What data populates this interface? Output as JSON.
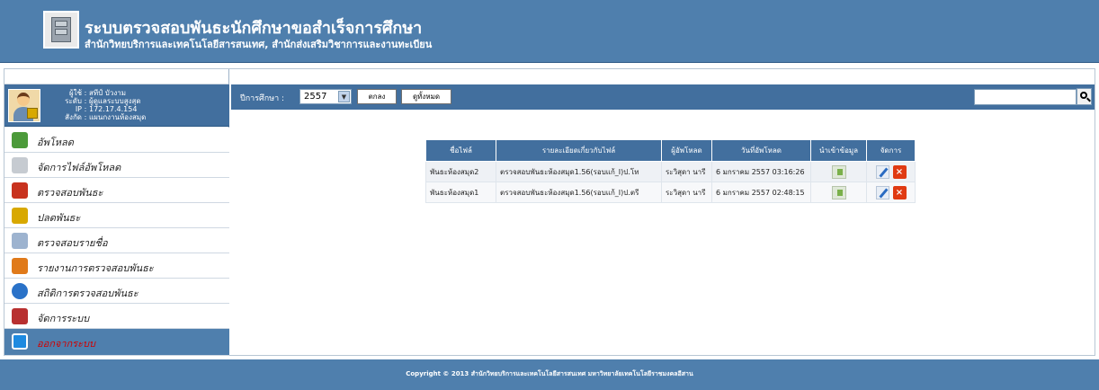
{
  "header": {
    "title": "ระบบตรวจสอบพันธะนักศึกษาขอสำเร็จการศึกษา",
    "subtitle": "สำนักวิทยบริการและเทคโนโลยีสารสนเทศ, สำนักส่งเสริมวิชาการและงานทะเบียน"
  },
  "user": {
    "fields": [
      {
        "key": "ผู้ใช้",
        "value": "สทีป์ บัวงาม"
      },
      {
        "key": "ระดับ",
        "value": "ผู้ดูแลระบบสูงสุด"
      },
      {
        "key": "IP",
        "value": "172.17.4.154"
      },
      {
        "key": "สังกัด",
        "value": "แผนกงานห้องสมุด"
      }
    ]
  },
  "menu": [
    {
      "label": "อัพโหลด",
      "icon": "upload-icon",
      "color": "#4c9a3a"
    },
    {
      "label": "จัดการไฟล์อัพโหลด",
      "icon": "file-manage-icon",
      "color": "#8a8f96"
    },
    {
      "label": "ตรวจสอบพันธะ",
      "icon": "user-check-icon",
      "color": "#c8321e"
    },
    {
      "label": "ปลดพันธะ",
      "icon": "user-release-icon",
      "color": "#d8a800"
    },
    {
      "label": "ตรวจสอบรายชื่อ",
      "icon": "magnifier-icon",
      "color": "#5a7fb2"
    },
    {
      "label": "รายงานการตรวจสอบพันธะ",
      "icon": "report-icon",
      "color": "#e07a1a"
    },
    {
      "label": "สถิติการตรวจสอบพันธะ",
      "icon": "pie-chart-icon",
      "color": "#2a72c8"
    },
    {
      "label": "จัดการระบบ",
      "icon": "tools-icon",
      "color": "#b83030"
    },
    {
      "label": "ออกจากระบบ",
      "icon": "power-icon",
      "color": "#1e8ae0"
    }
  ],
  "toolbar": {
    "year_label": "ปีการศึกษา :",
    "year_value": "2557",
    "search_button": "ตกลง",
    "show_all_button": "ดูทั้งหมด",
    "search_placeholder": ""
  },
  "table": {
    "headers": [
      "ชื่อไฟล์",
      "รายละเอียดเกี่ยวกับไฟล์",
      "ผู้อัพโหลด",
      "วันที่อัพโหลด",
      "นำเข้าข้อมูล",
      "จัดการ"
    ],
    "rows": [
      {
        "name": "พันธะห้องสมุด2",
        "desc": "ตรวจสอบพันธะห้องสมุด1.56(รอบแก้_I)ป.โท",
        "uploader": "ระวิสุดา นารี",
        "date": "6 มกราคม 2557 03:16:26"
      },
      {
        "name": "พันธะห้องสมุด1",
        "desc": "ตรวจสอบพันธะห้องสมุด1.56(รอบแก้_I)ป.ตรี",
        "uploader": "ระวิสุดา นารี",
        "date": "6 มกราคม 2557 02:48:15"
      }
    ]
  },
  "footer": {
    "text": "Copyright © 2013 สำนักวิทยบริการและเทคโนโลยีสารสนเทศ มหาวิทยาลัยเทคโนโลยีราชมงคลอีสาน"
  },
  "colors": {
    "header_bg": "#4f7fad",
    "bar_bg": "#426f9e",
    "logout_text": "#d00000"
  }
}
